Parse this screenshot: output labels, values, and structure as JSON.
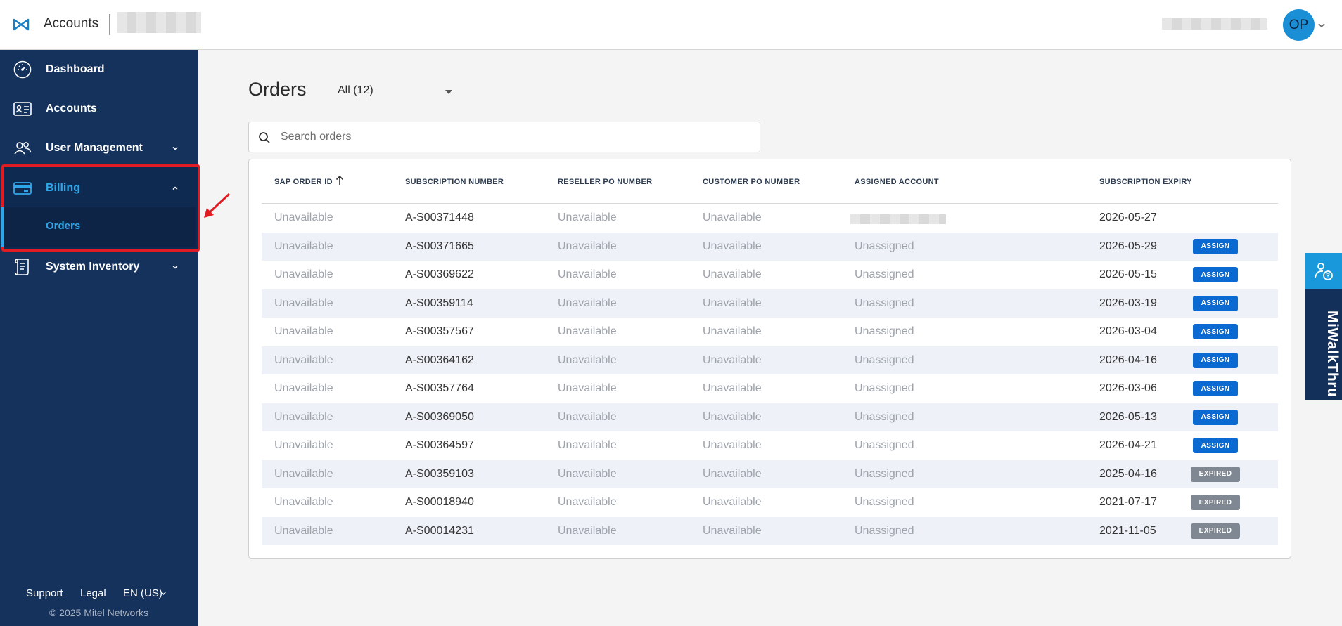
{
  "header": {
    "app_title": "Accounts",
    "avatar_initials": "OP"
  },
  "sidebar": {
    "items": [
      {
        "label": "Dashboard",
        "icon": "dashboard-gauge-icon"
      },
      {
        "label": "Accounts",
        "icon": "contact-card-icon"
      },
      {
        "label": "User Management",
        "icon": "users-icon"
      },
      {
        "label": "Billing",
        "icon": "credit-card-icon"
      },
      {
        "label": "System Inventory",
        "icon": "inventory-scroll-icon"
      }
    ],
    "sub_items": [
      {
        "label": "Orders"
      }
    ],
    "footer": {
      "support": "Support",
      "legal": "Legal",
      "language": "EN (US)",
      "copyright": "© 2025 Mitel Networks"
    }
  },
  "main": {
    "title": "Orders",
    "filter": "All (12)",
    "search_placeholder": "Search orders",
    "columns": [
      "SAP ORDER ID",
      "SUBSCRIPTION NUMBER",
      "RESELLER PO NUMBER",
      "CUSTOMER PO NUMBER",
      "ASSIGNED ACCOUNT",
      "SUBSCRIPTION EXPIRY"
    ],
    "rows": [
      {
        "sap": "Unavailable",
        "sub": "A-S00371448",
        "reseller": "Unavailable",
        "customer": "Unavailable",
        "account": "",
        "expiry": "2026-05-27",
        "action": ""
      },
      {
        "sap": "Unavailable",
        "sub": "A-S00371665",
        "reseller": "Unavailable",
        "customer": "Unavailable",
        "account": "Unassigned",
        "expiry": "2026-05-29",
        "action": "ASSIGN"
      },
      {
        "sap": "Unavailable",
        "sub": "A-S00369622",
        "reseller": "Unavailable",
        "customer": "Unavailable",
        "account": "Unassigned",
        "expiry": "2026-05-15",
        "action": "ASSIGN"
      },
      {
        "sap": "Unavailable",
        "sub": "A-S00359114",
        "reseller": "Unavailable",
        "customer": "Unavailable",
        "account": "Unassigned",
        "expiry": "2026-03-19",
        "action": "ASSIGN"
      },
      {
        "sap": "Unavailable",
        "sub": "A-S00357567",
        "reseller": "Unavailable",
        "customer": "Unavailable",
        "account": "Unassigned",
        "expiry": "2026-03-04",
        "action": "ASSIGN"
      },
      {
        "sap": "Unavailable",
        "sub": "A-S00364162",
        "reseller": "Unavailable",
        "customer": "Unavailable",
        "account": "Unassigned",
        "expiry": "2026-04-16",
        "action": "ASSIGN"
      },
      {
        "sap": "Unavailable",
        "sub": "A-S00357764",
        "reseller": "Unavailable",
        "customer": "Unavailable",
        "account": "Unassigned",
        "expiry": "2026-03-06",
        "action": "ASSIGN"
      },
      {
        "sap": "Unavailable",
        "sub": "A-S00369050",
        "reseller": "Unavailable",
        "customer": "Unavailable",
        "account": "Unassigned",
        "expiry": "2026-05-13",
        "action": "ASSIGN"
      },
      {
        "sap": "Unavailable",
        "sub": "A-S00364597",
        "reseller": "Unavailable",
        "customer": "Unavailable",
        "account": "Unassigned",
        "expiry": "2026-04-21",
        "action": "ASSIGN"
      },
      {
        "sap": "Unavailable",
        "sub": "A-S00359103",
        "reseller": "Unavailable",
        "customer": "Unavailable",
        "account": "Unassigned",
        "expiry": "2025-04-16",
        "action": "EXPIRED"
      },
      {
        "sap": "Unavailable",
        "sub": "A-S00018940",
        "reseller": "Unavailable",
        "customer": "Unavailable",
        "account": "Unassigned",
        "expiry": "2021-07-17",
        "action": "EXPIRED"
      },
      {
        "sap": "Unavailable",
        "sub": "A-S00014231",
        "reseller": "Unavailable",
        "customer": "Unavailable",
        "account": "Unassigned",
        "expiry": "2021-11-05",
        "action": "EXPIRED"
      }
    ]
  },
  "walkthru": {
    "label": "MiWalkThru",
    "icon": "help-person-icon"
  },
  "colors": {
    "sidebar_bg": "#15325c",
    "accent": "#2ea7ea",
    "assign_button": "#0a6ad1",
    "expired_badge": "#7f8793",
    "annotation_red": "#e01b24"
  }
}
